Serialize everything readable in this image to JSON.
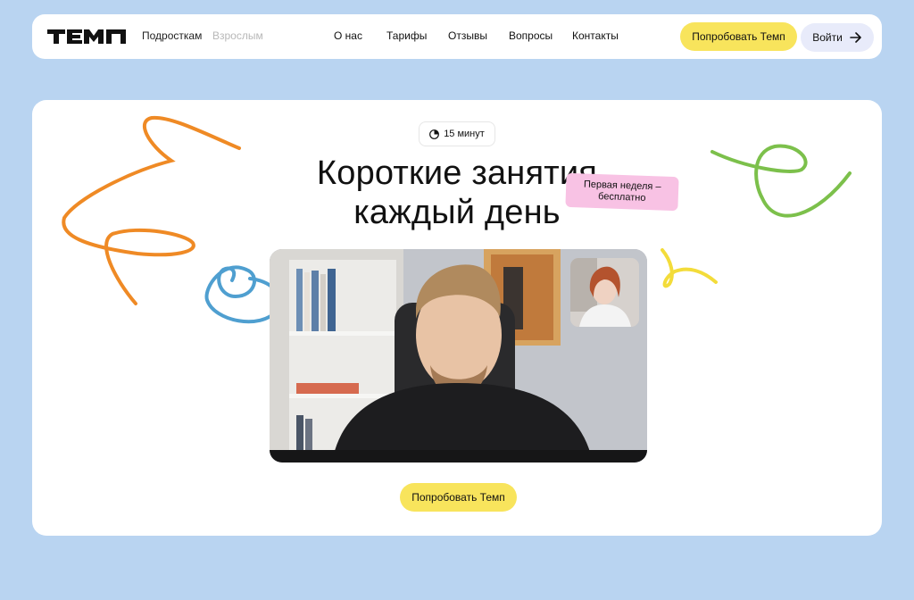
{
  "header": {
    "logo_text": "ТЕМП",
    "audience": {
      "teen": "Подросткам",
      "adult": "Взрослым"
    },
    "nav": [
      "О нас",
      "Тарифы",
      "Отзывы",
      "Вопросы",
      "Контакты"
    ],
    "try_button": "Попробовать Темп",
    "login_button": "Войти",
    "login_icon": "arrow-right-icon"
  },
  "hero": {
    "duration_pill": "15 минут",
    "duration_icon": "clock-icon",
    "title_line1": "Короткие занятия",
    "title_line2": "каждый день",
    "badge": "Первая неделя – бесплатно",
    "cta_button": "Попробовать Темп"
  },
  "colors": {
    "page_bg": "#b9d4f1",
    "accent_yellow": "#f8e45c",
    "badge_pink": "#f8c2e4",
    "login_bg": "#e8ebfa",
    "doodle_orange": "#ef8a25",
    "doodle_green": "#7cc04b",
    "doodle_blue": "#4f9fd0",
    "doodle_yellow": "#f3dc3a"
  }
}
